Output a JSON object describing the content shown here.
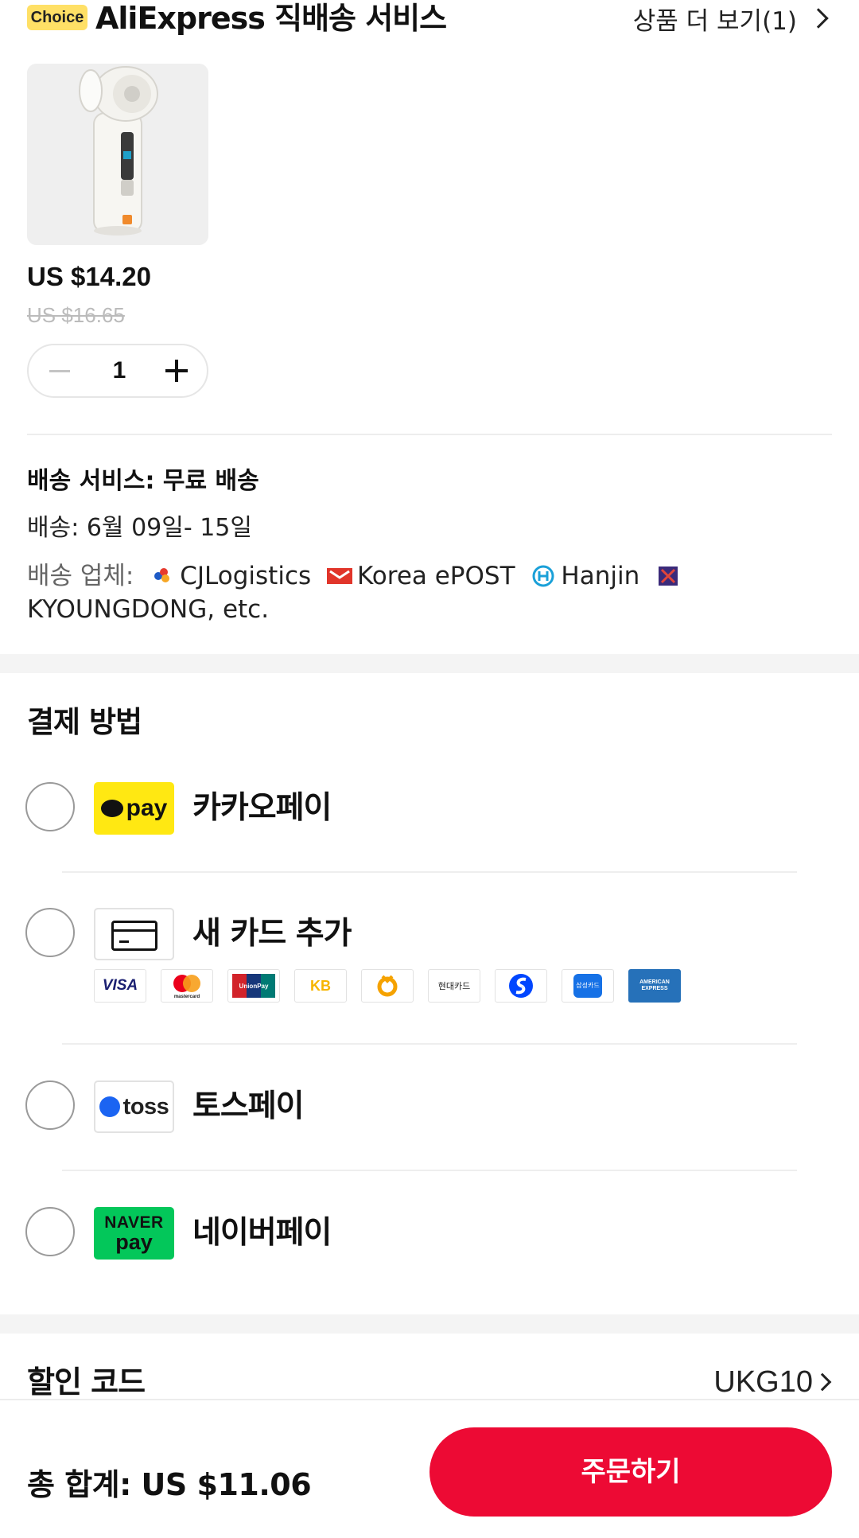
{
  "header": {
    "badge": "Choice",
    "store_title": "AliExpress 직배송 서비스",
    "more_link": "상품 더 보기(1)"
  },
  "product": {
    "price": "US $14.20",
    "original_price": "US $16.65",
    "quantity": "1"
  },
  "shipping": {
    "service_label": "배송 서비스:",
    "service_value": "무료 배송",
    "delivery_date": "배송: 6월 09일- 15일",
    "carriers_label": "배송 업체:",
    "carriers": [
      "CJLogistics",
      "Korea ePOST",
      "Hanjin"
    ],
    "carriers_more": "KYOUNGDONG, etc."
  },
  "payment": {
    "title": "결제 방법",
    "methods": [
      {
        "name": "카카오페이",
        "logo_text": "pay"
      },
      {
        "name": "새 카드 추가"
      },
      {
        "name": "토스페이",
        "logo_text": "toss"
      },
      {
        "name": "네이버페이",
        "logo_line1": "NAVER",
        "logo_line2": "pay"
      }
    ],
    "card_brands": [
      "VISA",
      "mastercard",
      "UnionPay",
      "KB",
      "NH",
      "현대카드",
      "Shinhan",
      "삼성카드",
      "AMERICAN EXPRESS"
    ]
  },
  "discount": {
    "label": "할인 코드",
    "value": "UKG10"
  },
  "footer": {
    "total_label": "총 합계:",
    "total_value": "US $11.06",
    "order_button": "주문하기"
  },
  "colors": {
    "accent": "#ed0a34",
    "choice_badge": "#ffe066",
    "kakao": "#ffe812",
    "naver": "#03c75a",
    "toss": "#1b64f2"
  }
}
